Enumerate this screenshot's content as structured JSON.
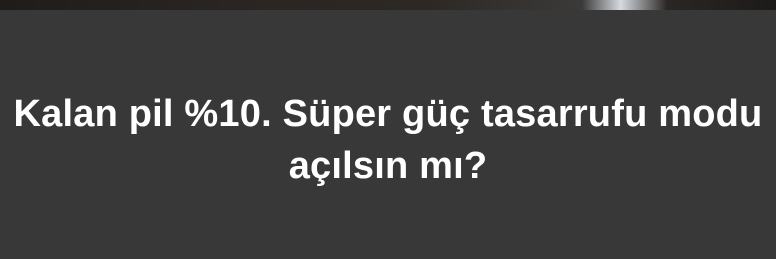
{
  "dialog": {
    "title": "Kalan pil %10. Süper güç tasarrufu modu açılsın mı?"
  }
}
